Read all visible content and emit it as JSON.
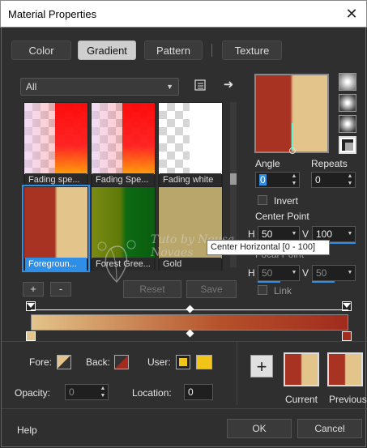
{
  "window": {
    "title": "Material Properties",
    "close": "✕"
  },
  "tabs": [
    "Color",
    "Gradient",
    "Pattern",
    "Texture"
  ],
  "filter": {
    "value": "All"
  },
  "gradients": [
    {
      "label": "Fading spe..."
    },
    {
      "label": "Fading Spe..."
    },
    {
      "label": "Fading white"
    },
    {
      "label": "Foregroun..."
    },
    {
      "label": "Forest Gree..."
    },
    {
      "label": "Gold"
    }
  ],
  "list_buttons": {
    "add": "+",
    "remove": "-",
    "reset": "Reset",
    "save": "Save"
  },
  "props": {
    "angle_label": "Angle",
    "angle": "0",
    "repeats_label": "Repeats",
    "repeats": "0",
    "invert_label": "Invert",
    "center_label": "Center Point",
    "h_label": "H",
    "center_h": "50",
    "v_label": "V",
    "center_v": "100",
    "focal_label": "Focal Point",
    "focal_h": "50",
    "focal_v": "50",
    "link_label": "Link"
  },
  "tooltip": "Center Horizontal [0 - 100]",
  "watermark": "Tuto by Neusa Novaes",
  "stops": {
    "fore_label": "Fore:",
    "back_label": "Back:",
    "user_label": "User:",
    "opacity_label": "Opacity:",
    "opacity": "0",
    "location_label": "Location:",
    "location": "0"
  },
  "compare": {
    "current_label": "Current",
    "previous_label": "Previous",
    "add": "+"
  },
  "footer": {
    "help": "Help",
    "ok": "OK",
    "cancel": "Cancel"
  },
  "colors": {
    "gradient_start": "#e3c48a",
    "gradient_end": "#a12b1e",
    "accent": "#2f8fe6",
    "user_color": "#f2c418"
  }
}
